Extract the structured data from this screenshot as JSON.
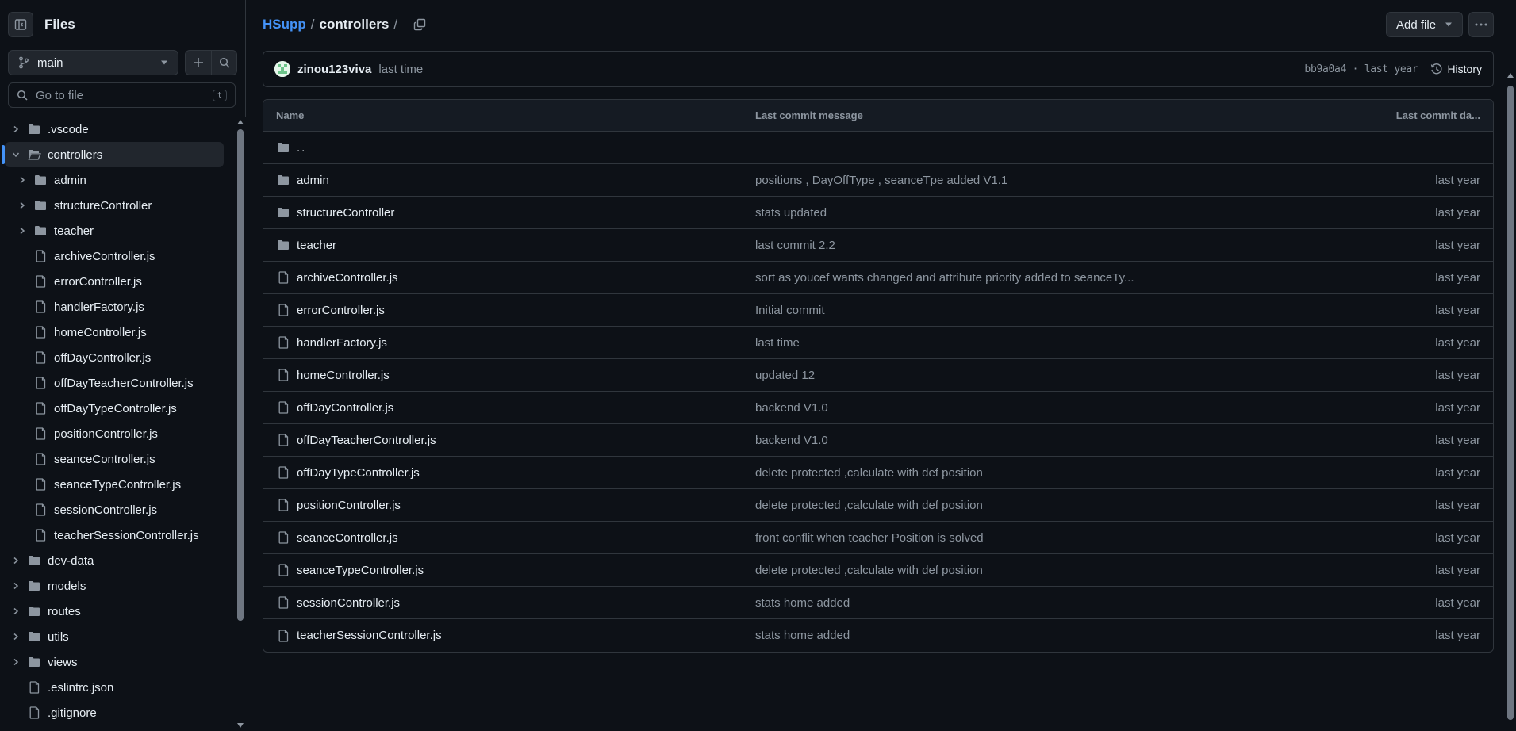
{
  "sidebar": {
    "title": "Files",
    "branch": "main",
    "search_placeholder": "Go to file",
    "search_shortcut": "t",
    "tree": [
      {
        "name": ".vscode",
        "type": "folder",
        "depth": 0,
        "expanded": false
      },
      {
        "name": "controllers",
        "type": "folder",
        "depth": 0,
        "expanded": true,
        "selected": true
      },
      {
        "name": "admin",
        "type": "folder",
        "depth": 1,
        "expanded": false
      },
      {
        "name": "structureController",
        "type": "folder",
        "depth": 1,
        "expanded": false
      },
      {
        "name": "teacher",
        "type": "folder",
        "depth": 1,
        "expanded": false
      },
      {
        "name": "archiveController.js",
        "type": "file",
        "depth": 1
      },
      {
        "name": "errorController.js",
        "type": "file",
        "depth": 1
      },
      {
        "name": "handlerFactory.js",
        "type": "file",
        "depth": 1
      },
      {
        "name": "homeController.js",
        "type": "file",
        "depth": 1
      },
      {
        "name": "offDayController.js",
        "type": "file",
        "depth": 1
      },
      {
        "name": "offDayTeacherController.js",
        "type": "file",
        "depth": 1
      },
      {
        "name": "offDayTypeController.js",
        "type": "file",
        "depth": 1
      },
      {
        "name": "positionController.js",
        "type": "file",
        "depth": 1
      },
      {
        "name": "seanceController.js",
        "type": "file",
        "depth": 1
      },
      {
        "name": "seanceTypeController.js",
        "type": "file",
        "depth": 1
      },
      {
        "name": "sessionController.js",
        "type": "file",
        "depth": 1
      },
      {
        "name": "teacherSessionController.js",
        "type": "file",
        "depth": 1
      },
      {
        "name": "dev-data",
        "type": "folder",
        "depth": 0,
        "expanded": false
      },
      {
        "name": "models",
        "type": "folder",
        "depth": 0,
        "expanded": false
      },
      {
        "name": "routes",
        "type": "folder",
        "depth": 0,
        "expanded": false
      },
      {
        "name": "utils",
        "type": "folder",
        "depth": 0,
        "expanded": false
      },
      {
        "name": "views",
        "type": "folder",
        "depth": 0,
        "expanded": false
      },
      {
        "name": ".eslintrc.json",
        "type": "file",
        "depth": 0
      },
      {
        "name": ".gitignore",
        "type": "file",
        "depth": 0
      }
    ]
  },
  "breadcrumb": {
    "repo": "HSupp",
    "sep1": "/",
    "current": "controllers",
    "sep2": "/"
  },
  "toolbar": {
    "add_file_label": "Add file"
  },
  "latest_commit": {
    "author": "zinou123viva",
    "message": "last time",
    "sha_time": "bb9a0a4 · last year",
    "history_label": "History"
  },
  "table": {
    "headers": {
      "name": "Name",
      "message": "Last commit message",
      "date": "Last commit da..."
    },
    "parent_dir": "..",
    "rows": [
      {
        "name": "admin",
        "type": "folder",
        "message": "positions , DayOffType , seanceTpe added V1.1",
        "date": "last year"
      },
      {
        "name": "structureController",
        "type": "folder",
        "message": "stats updated",
        "date": "last year"
      },
      {
        "name": "teacher",
        "type": "folder",
        "message": "last commit 2.2",
        "date": "last year"
      },
      {
        "name": "archiveController.js",
        "type": "file",
        "message": "sort as youcef wants changed and attribute priority added to seanceTy...",
        "date": "last year"
      },
      {
        "name": "errorController.js",
        "type": "file",
        "message": "Initial commit",
        "date": "last year"
      },
      {
        "name": "handlerFactory.js",
        "type": "file",
        "message": "last time",
        "date": "last year"
      },
      {
        "name": "homeController.js",
        "type": "file",
        "message": "updated 12",
        "date": "last year"
      },
      {
        "name": "offDayController.js",
        "type": "file",
        "message": "backend V1.0",
        "date": "last year"
      },
      {
        "name": "offDayTeacherController.js",
        "type": "file",
        "message": "backend V1.0",
        "date": "last year"
      },
      {
        "name": "offDayTypeController.js",
        "type": "file",
        "message": "delete protected ,calculate with def position",
        "date": "last year"
      },
      {
        "name": "positionController.js",
        "type": "file",
        "message": "delete protected ,calculate with def position",
        "date": "last year"
      },
      {
        "name": "seanceController.js",
        "type": "file",
        "message": "front conflit when teacher Position is solved",
        "date": "last year"
      },
      {
        "name": "seanceTypeController.js",
        "type": "file",
        "message": "delete protected ,calculate with def position",
        "date": "last year"
      },
      {
        "name": "sessionController.js",
        "type": "file",
        "message": "stats home added",
        "date": "last year"
      },
      {
        "name": "teacherSessionController.js",
        "type": "file",
        "message": "stats home added",
        "date": "last year"
      }
    ]
  },
  "colors": {
    "background": "#0d1117",
    "border": "#30363d",
    "accent": "#4493f8",
    "muted": "#8d96a0",
    "text": "#e6edf3"
  }
}
